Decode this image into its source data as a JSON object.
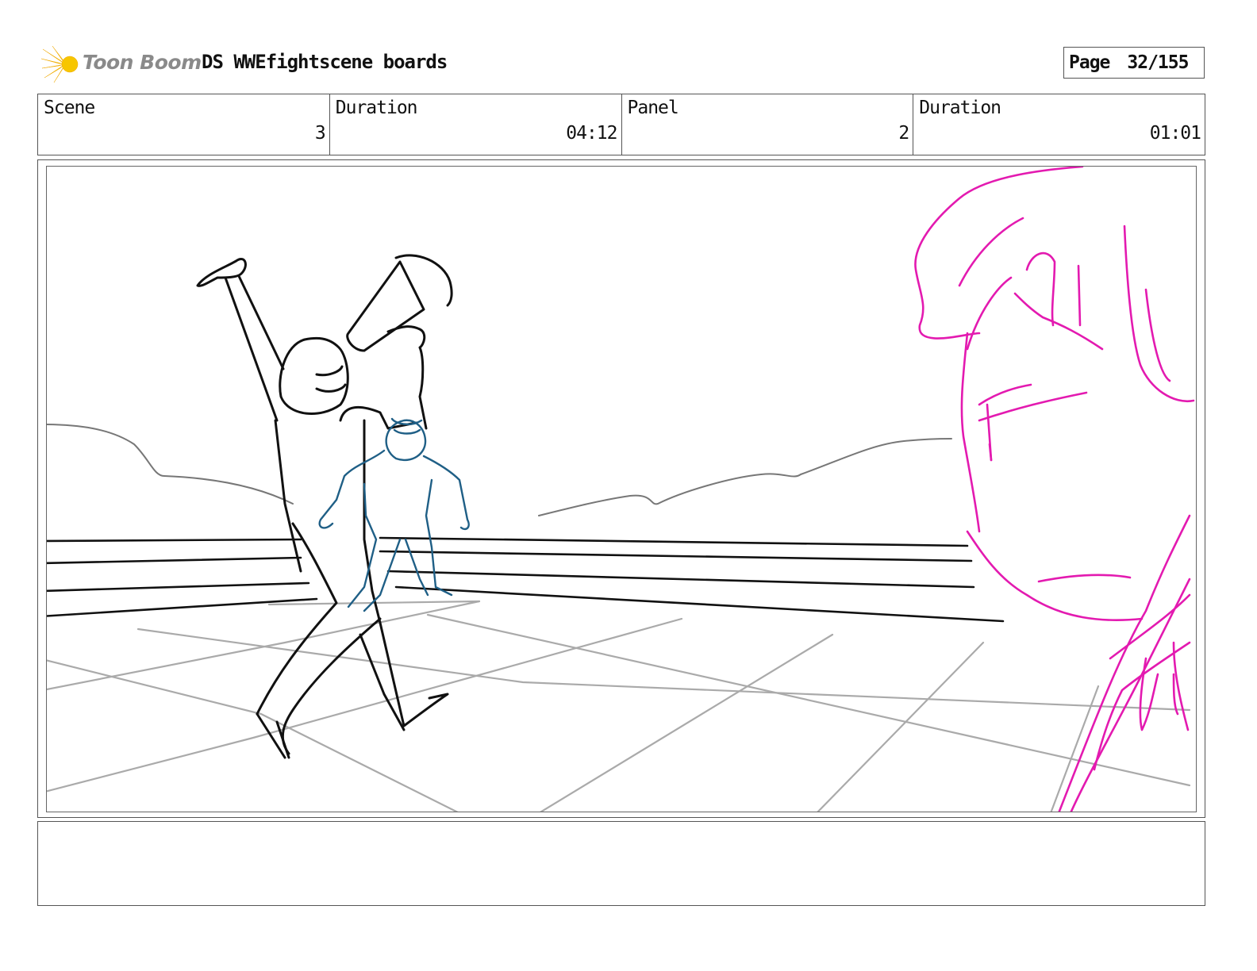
{
  "header": {
    "logo_text": "Toon Boom",
    "project_title": "DS WWEfightscene boards",
    "page_label": "Page",
    "page_value": "32/155"
  },
  "info": {
    "scene_label": "Scene",
    "scene_value": "3",
    "scene_duration_label": "Duration",
    "scene_duration_value": "04:12",
    "panel_label": "Panel",
    "panel_value": "2",
    "panel_duration_label": "Duration",
    "panel_duration_value": "01:01"
  },
  "sketch": {
    "colors": {
      "ink": "#111111",
      "background_lines": "#aaaaaa",
      "hills": "#777777",
      "blue_figure": "#1f5f86",
      "magenta_face": "#e31ab0"
    }
  },
  "caption": {
    "text": ""
  }
}
